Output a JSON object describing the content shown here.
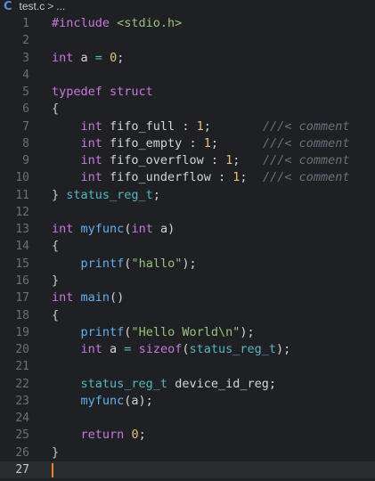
{
  "breadcrumb": {
    "icon": "c-file-icon",
    "icon_glyph": "C",
    "filename": "test.c",
    "separator": ">",
    "rest": "..."
  },
  "editor": {
    "current_line": 27,
    "lines": [
      {
        "n": "1",
        "tokens": [
          [
            "pp",
            "#include "
          ],
          [
            "str",
            "<stdio.h>"
          ]
        ]
      },
      {
        "n": "2",
        "tokens": []
      },
      {
        "n": "3",
        "tokens": [
          [
            "kw",
            "int"
          ],
          [
            "id",
            " a "
          ],
          [
            "op",
            "="
          ],
          [
            "id",
            " "
          ],
          [
            "num",
            "0"
          ],
          [
            "id",
            ";"
          ]
        ]
      },
      {
        "n": "4",
        "tokens": []
      },
      {
        "n": "5",
        "tokens": [
          [
            "kw",
            "typedef struct"
          ]
        ]
      },
      {
        "n": "6",
        "tokens": [
          [
            "br",
            "{"
          ]
        ]
      },
      {
        "n": "7",
        "tokens": [
          [
            "id",
            "    "
          ],
          [
            "kw",
            "int"
          ],
          [
            "id",
            " fifo_full "
          ],
          [
            "id",
            ": "
          ],
          [
            "num",
            "1"
          ],
          [
            "id",
            ";"
          ]
        ],
        "comment": "///< comment"
      },
      {
        "n": "8",
        "tokens": [
          [
            "id",
            "    "
          ],
          [
            "kw",
            "int"
          ],
          [
            "id",
            " fifo_empty "
          ],
          [
            "id",
            ": "
          ],
          [
            "num",
            "1"
          ],
          [
            "id",
            ";"
          ]
        ],
        "comment": "///< comment"
      },
      {
        "n": "9",
        "tokens": [
          [
            "id",
            "    "
          ],
          [
            "kw",
            "int"
          ],
          [
            "id",
            " fifo_overflow "
          ],
          [
            "id",
            ": "
          ],
          [
            "num",
            "1"
          ],
          [
            "id",
            ";"
          ]
        ],
        "comment": "///< comment"
      },
      {
        "n": "10",
        "tokens": [
          [
            "id",
            "    "
          ],
          [
            "kw",
            "int"
          ],
          [
            "id",
            " fifo_underflow "
          ],
          [
            "id",
            ": "
          ],
          [
            "num",
            "1"
          ],
          [
            "id",
            ";"
          ]
        ],
        "comment": "///< comment"
      },
      {
        "n": "11",
        "tokens": [
          [
            "br",
            "} "
          ],
          [
            "ty",
            "status_reg_t"
          ],
          [
            "id",
            ";"
          ]
        ]
      },
      {
        "n": "12",
        "tokens": []
      },
      {
        "n": "13",
        "tokens": [
          [
            "kw",
            "int"
          ],
          [
            "id",
            " "
          ],
          [
            "fn",
            "myfunc"
          ],
          [
            "id",
            "("
          ],
          [
            "kw",
            "int"
          ],
          [
            "id",
            " a)"
          ]
        ]
      },
      {
        "n": "14",
        "tokens": [
          [
            "br",
            "{"
          ]
        ]
      },
      {
        "n": "15",
        "tokens": [
          [
            "id",
            "    "
          ],
          [
            "fn",
            "printf"
          ],
          [
            "id",
            "("
          ],
          [
            "str",
            "\"hallo\""
          ],
          [
            "id",
            ");"
          ]
        ]
      },
      {
        "n": "16",
        "tokens": [
          [
            "br",
            "}"
          ]
        ]
      },
      {
        "n": "17",
        "tokens": [
          [
            "kw",
            "int"
          ],
          [
            "id",
            " "
          ],
          [
            "fn",
            "main"
          ],
          [
            "id",
            "()"
          ]
        ]
      },
      {
        "n": "18",
        "tokens": [
          [
            "br",
            "{"
          ]
        ]
      },
      {
        "n": "19",
        "tokens": [
          [
            "id",
            "    "
          ],
          [
            "fn",
            "printf"
          ],
          [
            "id",
            "("
          ],
          [
            "str",
            "\"Hello World\\n\""
          ],
          [
            "id",
            ");"
          ]
        ]
      },
      {
        "n": "20",
        "tokens": [
          [
            "id",
            "    "
          ],
          [
            "kw",
            "int"
          ],
          [
            "id",
            " a "
          ],
          [
            "op",
            "="
          ],
          [
            "id",
            " "
          ],
          [
            "kw",
            "sizeof"
          ],
          [
            "id",
            "("
          ],
          [
            "ty",
            "status_reg_t"
          ],
          [
            "id",
            ");"
          ]
        ]
      },
      {
        "n": "21",
        "tokens": []
      },
      {
        "n": "22",
        "tokens": [
          [
            "id",
            "    "
          ],
          [
            "ty",
            "status_reg_t"
          ],
          [
            "id",
            " device_id_reg;"
          ]
        ]
      },
      {
        "n": "23",
        "tokens": [
          [
            "id",
            "    "
          ],
          [
            "fn",
            "myfunc"
          ],
          [
            "id",
            "(a);"
          ]
        ]
      },
      {
        "n": "24",
        "tokens": []
      },
      {
        "n": "25",
        "tokens": [
          [
            "id",
            "    "
          ],
          [
            "kw",
            "return"
          ],
          [
            "id",
            " "
          ],
          [
            "num",
            "0"
          ],
          [
            "id",
            ";"
          ]
        ]
      },
      {
        "n": "26",
        "tokens": [
          [
            "br",
            "}"
          ]
        ]
      },
      {
        "n": "27",
        "tokens": []
      }
    ]
  },
  "colors": {
    "background": "#1f2024",
    "keyword": "#c678dd",
    "string": "#98c379",
    "number": "#e5c07b",
    "function": "#61afef",
    "type": "#56b6c2",
    "comment": "#6b6f78",
    "cursor": "#e0873a"
  }
}
